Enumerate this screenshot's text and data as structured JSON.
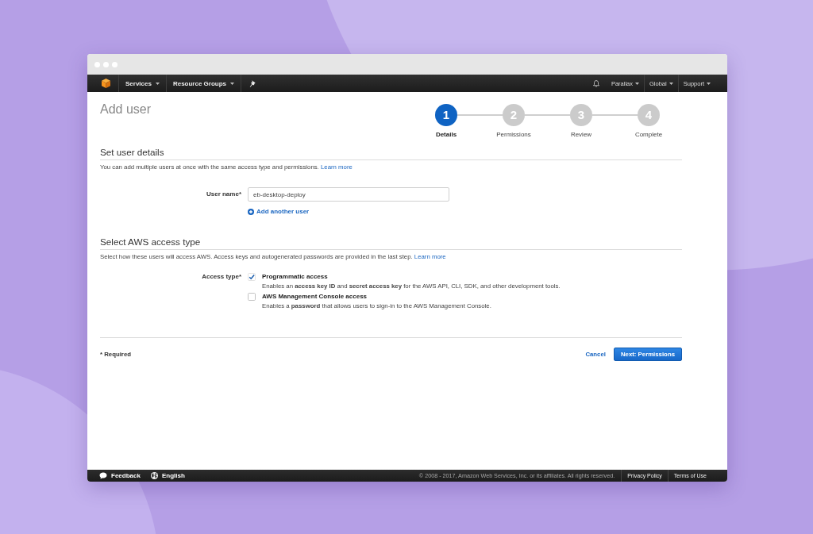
{
  "nav_bar": {
    "left_menus": [
      "Services",
      "Resource Groups"
    ],
    "right_menus": [
      "Parallax",
      "Global",
      "Support"
    ]
  },
  "page_title": "Add user",
  "steps": [
    {
      "number": "1",
      "label": "Details",
      "selected": true
    },
    {
      "number": "2",
      "label": "Permissions",
      "selected": false
    },
    {
      "number": "3",
      "label": "Review",
      "selected": false
    },
    {
      "number": "4",
      "label": "Complete",
      "selected": false
    }
  ],
  "user_details": {
    "heading": "Set user details",
    "description": "You can add multiple users at once with the same access type and permissions.",
    "link": "Learn more",
    "field": {
      "label": "User name*",
      "value": "eb-desktop-deploy"
    },
    "add_link": "Add another user"
  },
  "access_type": {
    "heading": "Select AWS access type",
    "description": "Select how these users will access AWS. Access keys and autogenerated passwords are provided in the last step.",
    "link": "Learn more",
    "label": "Access type*",
    "options": [
      {
        "label": "Programmatic access",
        "description": "Enables an **access key ID** and **secret access key** for the AWS API, CLI, SDK, and other development tools.",
        "checked": true
      },
      {
        "label": "AWS Management Console access",
        "description": "Enables a **password** that allows users to sign-in to the AWS Management Console.",
        "checked": false
      }
    ]
  },
  "form_footer": {
    "required_note": "* Required",
    "cancel": "Cancel",
    "next": "Next: Permissions"
  },
  "status_bar": {
    "feedback": "Feedback",
    "language": "English",
    "copyright": "© 2008 - 2017, Amazon Web Services, Inc. or its affiliates. All rights reserved.",
    "links": [
      "Privacy Policy",
      "Terms of Use"
    ]
  }
}
